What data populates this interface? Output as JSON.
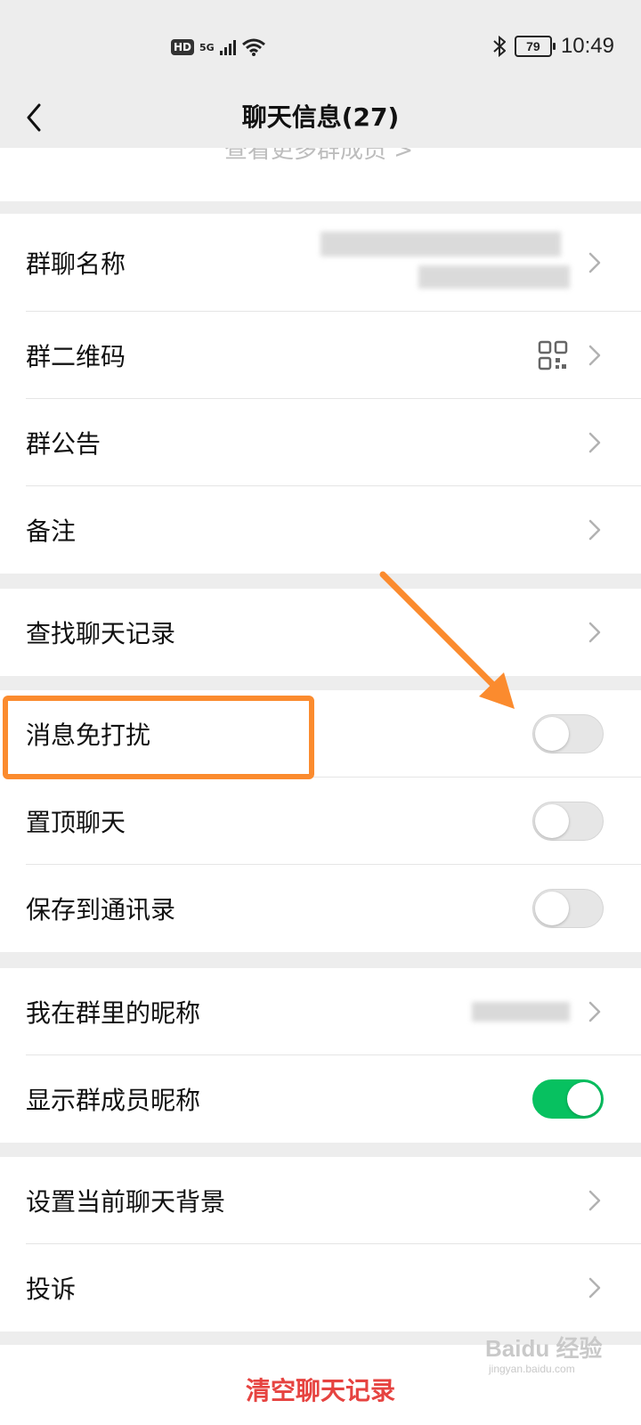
{
  "status_bar": {
    "hd": "HD",
    "network": "5G",
    "battery": "79",
    "time": "10:49",
    "icons": [
      "wifi-icon",
      "bluetooth-icon",
      "battery-icon"
    ]
  },
  "nav": {
    "title": "聊天信息(27)",
    "back_icon": "chevron-left-icon"
  },
  "faded_link": "查看更多群成员 >",
  "groups": {
    "info": [
      "群聊名称",
      "群二维码",
      "群公告",
      "备注"
    ],
    "search": "查找聊天记录",
    "toggles": [
      "消息免打扰",
      "置顶聊天",
      "保存到通讯录"
    ],
    "toggle_states": [
      false,
      false,
      false
    ],
    "nick": [
      "我在群里的昵称",
      "显示群成员昵称"
    ],
    "show_nick_on": true,
    "misc": [
      "设置当前聊天背景",
      "投诉"
    ]
  },
  "clear_history": "清空聊天记录",
  "watermark": "Baidu 经验",
  "watermark_url": "jingyan.baidu.com",
  "colors": {
    "background": "#ededed",
    "toggle_on": "#07c160",
    "danger": "#e64340",
    "highlight": "#fb8b2e"
  }
}
